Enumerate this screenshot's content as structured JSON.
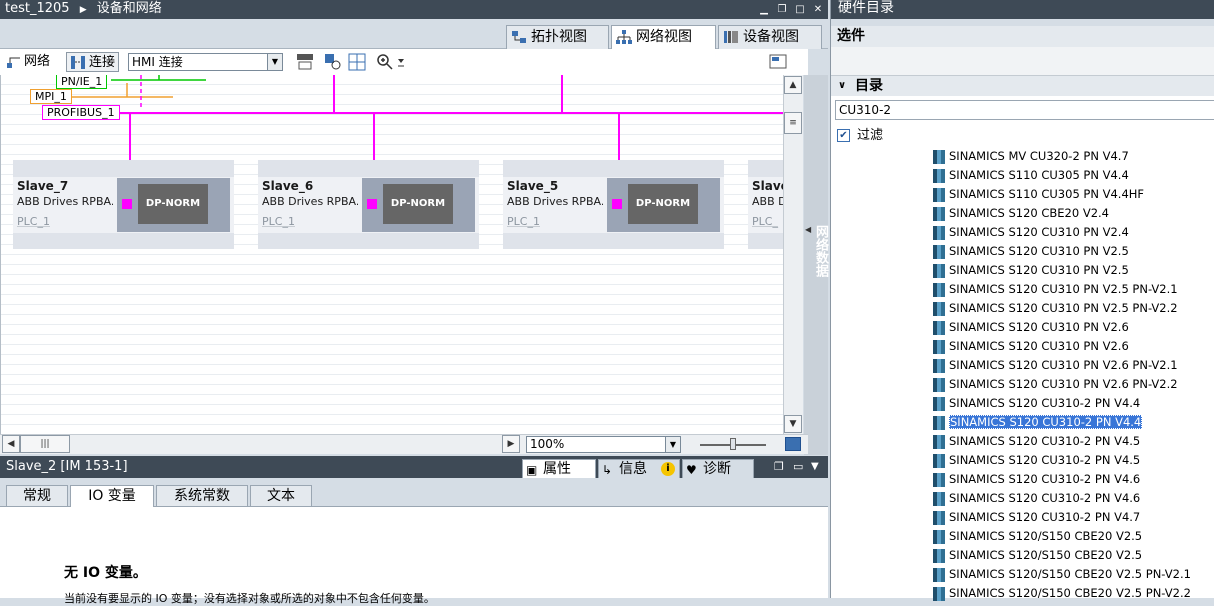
{
  "editor": {
    "project": "test_1205",
    "breadcrumb_sep": "▶",
    "section": "设备和网络"
  },
  "view_tabs": [
    {
      "label": "拓扑视图",
      "icon": "topology-view-icon"
    },
    {
      "label": "网络视图",
      "icon": "network-view-icon"
    },
    {
      "label": "设备视图",
      "icon": "device-view-icon"
    }
  ],
  "toolbar": {
    "network_label": "网络",
    "connect_label": "连接",
    "connection_type": "HMI 连接"
  },
  "networks": {
    "pn": "PN/IE_1",
    "mpi": "MPI_1",
    "profibus": "PROFIBUS_1",
    "colors": {
      "pn": "#00c800",
      "mpi": "#f0a030",
      "profibus": "#ff00ff"
    }
  },
  "nodes": [
    {
      "name": "Slave_7",
      "type": "ABB Drives RPBA...",
      "master": "PLC_1",
      "module": "DP-NORM"
    },
    {
      "name": "Slave_6",
      "type": "ABB Drives RPBA...",
      "master": "PLC_1",
      "module": "DP-NORM"
    },
    {
      "name": "Slave_5",
      "type": "ABB Drives RPBA...",
      "master": "PLC_1",
      "module": "DP-NORM"
    },
    {
      "name": "Slave_",
      "type": "ABB D",
      "master": "PLC_"
    }
  ],
  "side_tab": {
    "label": "网络数据"
  },
  "zoom": "100%",
  "inspector": {
    "title": "Slave_2 [IM 153-1]",
    "tabs": [
      {
        "label": "属性"
      },
      {
        "label": "信息"
      },
      {
        "label": "诊断"
      }
    ],
    "subtabs": [
      "常规",
      "IO 变量",
      "系统常数",
      "文本"
    ],
    "message": "无 IO 变量。",
    "detail": "当前没有要显示的 IO 变量；没有选择对象或所选的对象中不包含任何变量。"
  },
  "catalog": {
    "title": "硬件目录",
    "options_label": "选件",
    "catalog_label": "目录",
    "search_value": "CU310-2",
    "filter_label": "过滤",
    "filter_checked": true,
    "items": [
      "SINAMICS MV CU320-2 PN V4.7",
      "SINAMICS S110 CU305 PN V4.4",
      "SINAMICS S110 CU305 PN V4.4HF",
      "SINAMICS S120 CBE20 V2.4",
      "SINAMICS S120 CU310 PN V2.4",
      "SINAMICS S120 CU310 PN V2.5",
      "SINAMICS S120 CU310 PN V2.5",
      "SINAMICS S120 CU310 PN V2.5 PN-V2.1",
      "SINAMICS S120 CU310 PN V2.5 PN-V2.2",
      "SINAMICS S120 CU310 PN V2.6",
      "SINAMICS S120 CU310 PN V2.6",
      "SINAMICS S120 CU310 PN V2.6 PN-V2.1",
      "SINAMICS S120 CU310 PN V2.6 PN-V2.2",
      "SINAMICS S120 CU310-2 PN V4.4",
      "SINAMICS S120 CU310-2 PN V4.4",
      "SINAMICS S120 CU310-2 PN V4.5",
      "SINAMICS S120 CU310-2 PN V4.5",
      "SINAMICS S120 CU310-2 PN V4.6",
      "SINAMICS S120 CU310-2 PN V4.6",
      "SINAMICS S120 CU310-2 PN V4.7",
      "SINAMICS S120/S150 CBE20 V2.5",
      "SINAMICS S120/S150 CBE20 V2.5",
      "SINAMICS S120/S150 CBE20 V2.5 PN-V2.1",
      "SINAMICS S120/S150 CBE20 V2.5 PN-V2.2"
    ],
    "selected_index": 14
  }
}
